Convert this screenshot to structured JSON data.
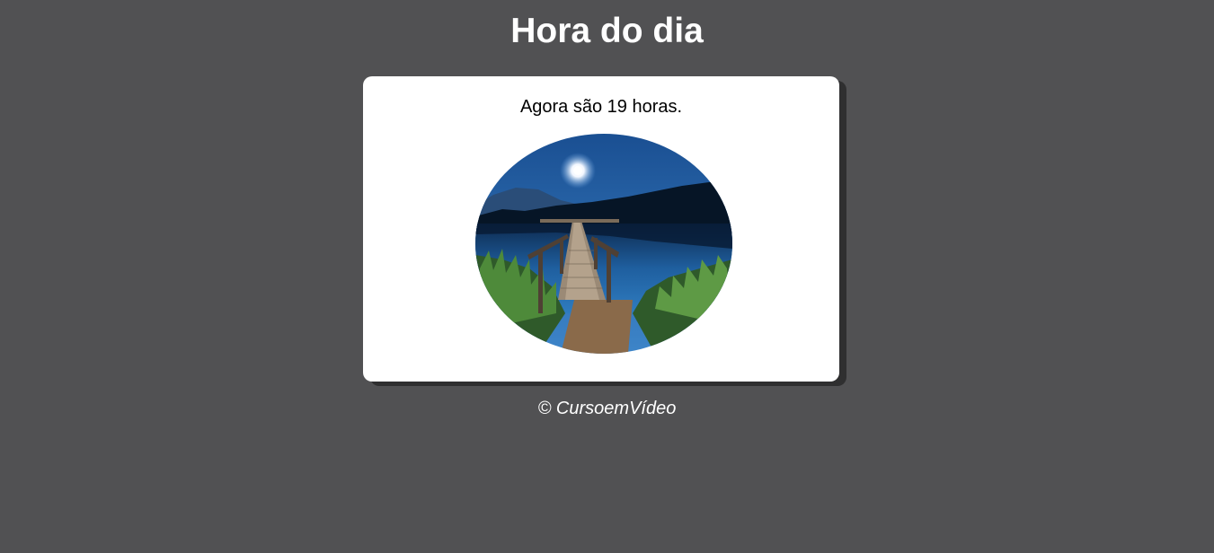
{
  "header": {
    "title": "Hora do dia"
  },
  "card": {
    "message": "Agora são 19 horas.",
    "image": {
      "alt": "Imagem da noite"
    }
  },
  "footer": {
    "text": "© CursoemVídeo"
  },
  "colors": {
    "background": "#515153",
    "card": "#ffffff",
    "shadow": "#2f2f30"
  }
}
